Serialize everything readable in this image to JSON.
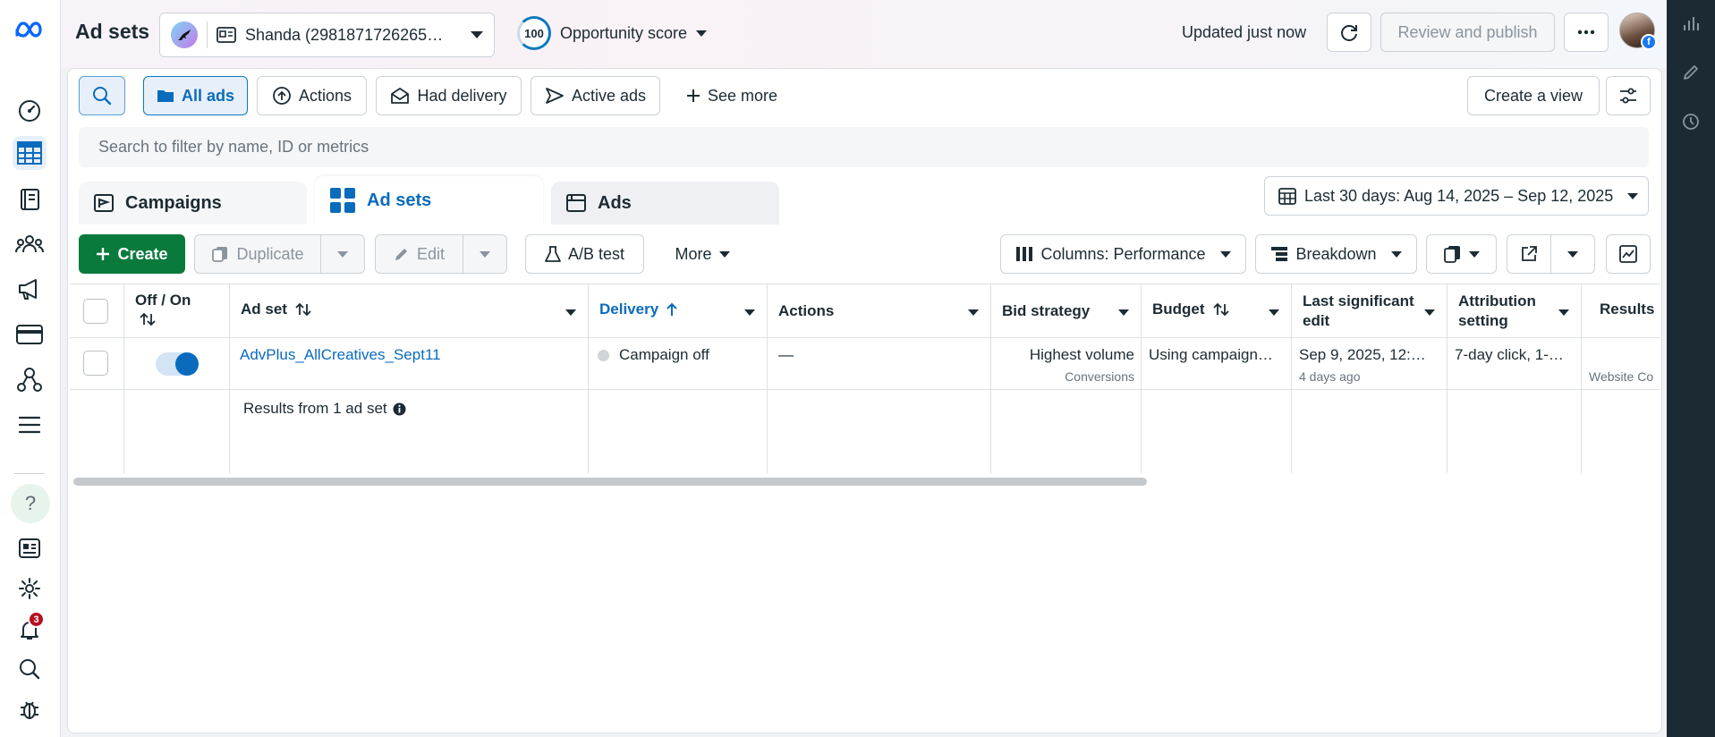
{
  "header": {
    "title": "Ad sets",
    "account_name": "Shanda (2981871726265…",
    "opportunity_score_value": "100",
    "opportunity_score_label": "Opportunity score",
    "updated": "Updated just now",
    "review_publish": "Review and publish"
  },
  "filters": {
    "all_ads": "All ads",
    "actions": "Actions",
    "had_delivery": "Had delivery",
    "active_ads": "Active ads",
    "see_more": "See more",
    "create_view": "Create a view"
  },
  "search": {
    "placeholder": "Search to filter by name, ID or metrics"
  },
  "tabs": [
    {
      "label": "Campaigns"
    },
    {
      "label": "Ad sets"
    },
    {
      "label": "Ads"
    }
  ],
  "date_range": "Last 30 days: Aug 14, 2025 – Sep 12, 2025",
  "toolbar": {
    "create": "Create",
    "duplicate": "Duplicate",
    "edit": "Edit",
    "ab_test": "A/B test",
    "more": "More",
    "columns": "Columns: Performance",
    "breakdown": "Breakdown"
  },
  "table": {
    "headers": {
      "off_on": "Off / On",
      "ad_set": "Ad set",
      "delivery": "Delivery",
      "actions": "Actions",
      "bid_strategy": "Bid strategy",
      "budget": "Budget",
      "last_edit_1": "Last significant",
      "last_edit_2": "edit",
      "attribution_1": "Attribution",
      "attribution_2": "setting",
      "results": "Results"
    },
    "row": {
      "ad_set": "AdvPlus_AllCreatives_Sept11",
      "delivery": "Campaign off",
      "actions": "—",
      "bid_strategy": "Highest volume",
      "bid_strategy_sub": "Conversions",
      "budget": "Using campaign…",
      "last_edit": "Sep 9, 2025, 12:…",
      "last_edit_sub": "4 days ago",
      "attribution": "7-day click, 1-…",
      "results_sub": "Website Co"
    },
    "summary": "Results from 1 ad set"
  },
  "notifications_count": "3",
  "colors": {
    "accent": "#0a78be",
    "create_green": "#0a7a3c",
    "rail": "#1c2b33"
  }
}
